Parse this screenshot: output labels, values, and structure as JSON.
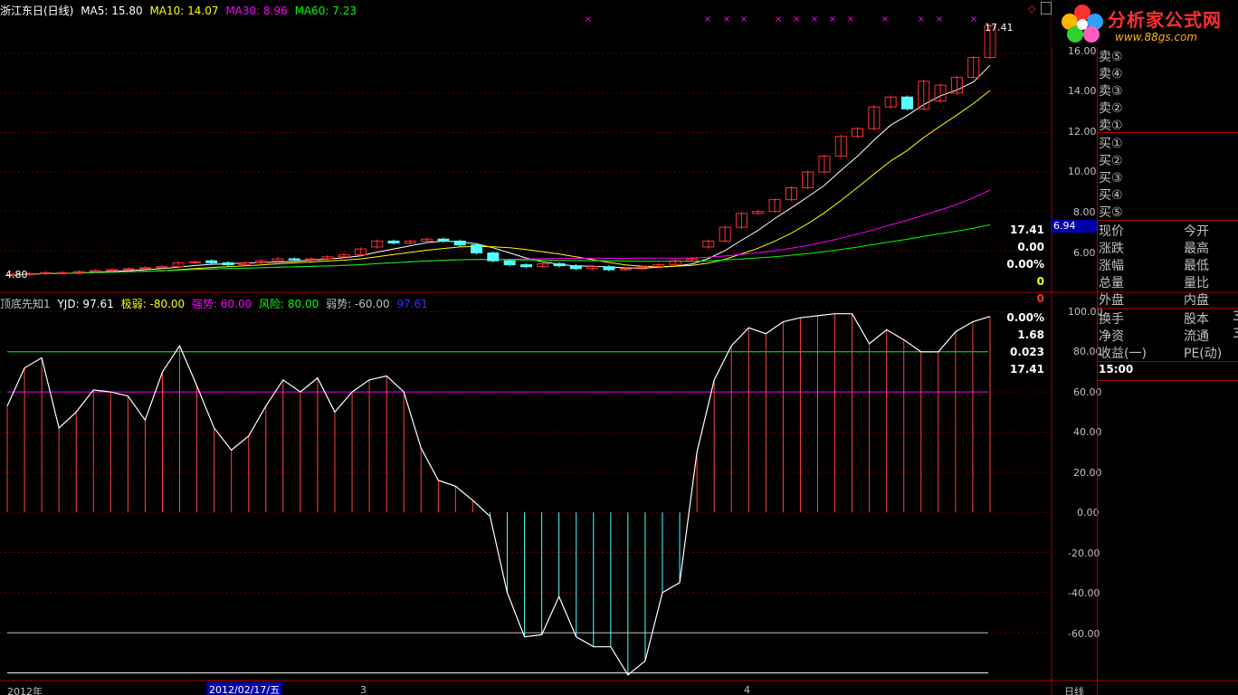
{
  "header": {
    "title": "浙江东日(日线)",
    "ma5_label": "MA5: 15.80",
    "ma10_label": "MA10: 14.07",
    "ma30_label": "MA30: 8.96",
    "ma60_label": "MA60: 7.23",
    "colors": {
      "title": "#ffffff",
      "ma5": "#ffffff",
      "ma10": "#ffff00",
      "ma30": "#ff00ff",
      "ma60": "#00ff00"
    }
  },
  "indicator_header": {
    "name": "顶底先知1",
    "yjd": "YJD: 97.61",
    "jiruo": "极弱: -80.00",
    "qiangshi": "强势: 60.00",
    "fengxian": "风险: 80.00",
    "ruoshi": "弱势: -60.00",
    "extra": "97.61"
  },
  "price_axis": [
    "16.00",
    "14.00",
    "12.00",
    "10.00",
    "8.00",
    "6.00"
  ],
  "price_current_tag": "6.94",
  "last_price_label": "17.41",
  "start_price_label": "4.80",
  "indicator_axis": [
    "100.00",
    "80.00",
    "60.00",
    "40.00",
    "20.00",
    "0.00",
    "-20.00",
    "-40.00",
    "-60.00"
  ],
  "bottom": {
    "year": "2012年",
    "date_box": "2012/02/17/五",
    "m3": "3",
    "m4": "4",
    "period": "日线"
  },
  "logo": {
    "name": "分析家公式网",
    "url": "www.88gs.com"
  },
  "order_book": {
    "sells": [
      "卖⑤",
      "卖④",
      "卖③",
      "卖②",
      "卖①"
    ],
    "buys": [
      "买①",
      "买②",
      "买③",
      "买④",
      "买⑤"
    ]
  },
  "quote": [
    {
      "label": "现价",
      "value": "17.41",
      "label2": "今开",
      "color": "#ffffff"
    },
    {
      "label": "涨跌",
      "value": "0.00",
      "label2": "最高",
      "color": "#ffffff"
    },
    {
      "label": "涨幅",
      "value": "0.00%",
      "label2": "最低",
      "color": "#ffffff"
    },
    {
      "label": "总量",
      "value": "0",
      "label2": "量比",
      "color": "#ffff00"
    },
    {
      "label": "外盘",
      "value": "0",
      "label2": "内盘",
      "color": "#ff3030"
    }
  ],
  "stats": [
    {
      "label": "换手",
      "value": "0.00%",
      "label2": "股本",
      "extra": "3"
    },
    {
      "label": "净资",
      "value": "1.68",
      "label2": "流通",
      "extra": "3"
    },
    {
      "label": "收益(一)",
      "value": "0.023",
      "label2": "PE(动)",
      "extra": ""
    }
  ],
  "tick": {
    "time": "15:00",
    "price": "17.41"
  },
  "chart_data": [
    {
      "type": "candlestick",
      "title": "浙江东日(日线)",
      "series": [
        {
          "name": "K",
          "open": [
            4.8,
            4.8,
            4.85,
            4.9,
            4.9,
            4.95,
            5.0,
            5.05,
            5.1,
            5.15,
            5.2,
            5.4,
            5.5,
            5.4,
            5.3,
            5.4,
            5.5,
            5.6,
            5.55,
            5.6,
            5.7,
            5.8,
            6.2,
            6.5,
            6.4,
            6.5,
            6.6,
            6.5,
            6.3,
            5.9,
            5.5,
            5.3,
            5.2,
            5.35,
            5.25,
            5.1,
            5.2,
            5.05,
            5.1,
            5.2,
            5.3,
            5.5,
            6.2,
            6.5,
            7.2,
            7.9,
            8.0,
            8.6,
            9.2,
            10.0,
            10.8,
            11.8,
            12.2,
            13.3,
            13.8,
            13.2,
            13.6,
            14.0,
            14.8,
            15.8
          ],
          "close": [
            4.8,
            4.85,
            4.9,
            4.9,
            4.95,
            5.0,
            5.05,
            5.1,
            5.15,
            5.2,
            5.4,
            5.45,
            5.4,
            5.3,
            5.4,
            5.5,
            5.6,
            5.55,
            5.6,
            5.7,
            5.8,
            6.1,
            6.5,
            6.4,
            6.5,
            6.6,
            6.5,
            6.3,
            5.9,
            5.5,
            5.3,
            5.2,
            5.35,
            5.25,
            5.1,
            5.2,
            5.05,
            5.1,
            5.2,
            5.3,
            5.5,
            5.6,
            6.5,
            7.2,
            7.9,
            8.0,
            8.6,
            9.2,
            10.0,
            10.8,
            11.8,
            12.2,
            13.3,
            13.8,
            13.2,
            14.6,
            14.4,
            14.8,
            15.8,
            17.41
          ]
        }
      ],
      "ma": [
        {
          "name": "MA5",
          "value": 15.8,
          "color": "#ffffff"
        },
        {
          "name": "MA10",
          "value": 14.07,
          "color": "#ffff00"
        },
        {
          "name": "MA30",
          "value": 8.96,
          "color": "#ff00ff"
        },
        {
          "name": "MA60",
          "value": 7.23,
          "color": "#00ff00"
        }
      ],
      "ylim": [
        4.5,
        17.8
      ]
    },
    {
      "type": "line",
      "title": "顶底先知1",
      "series": [
        {
          "name": "YJD",
          "values": [
            53,
            72,
            77,
            42,
            50,
            61,
            60,
            58,
            46,
            70,
            83,
            63,
            42,
            31,
            38,
            53,
            66,
            60,
            67,
            50,
            60,
            66,
            68,
            60,
            32,
            16,
            13,
            6,
            -2,
            -40,
            -62,
            -61,
            -42,
            -62,
            -67,
            -67,
            -81,
            -74,
            -40,
            -35,
            30,
            66,
            83,
            92,
            89,
            95,
            97,
            98,
            99,
            99,
            84,
            91,
            86,
            80,
            80,
            90,
            95,
            97.61
          ]
        },
        {
          "name": "强势",
          "value": 60.0
        },
        {
          "name": "风险",
          "value": 80.0
        },
        {
          "name": "弱势",
          "value": -60.0
        },
        {
          "name": "极弱",
          "value": -80.0
        }
      ],
      "ylim": [
        -82,
        102
      ]
    }
  ]
}
